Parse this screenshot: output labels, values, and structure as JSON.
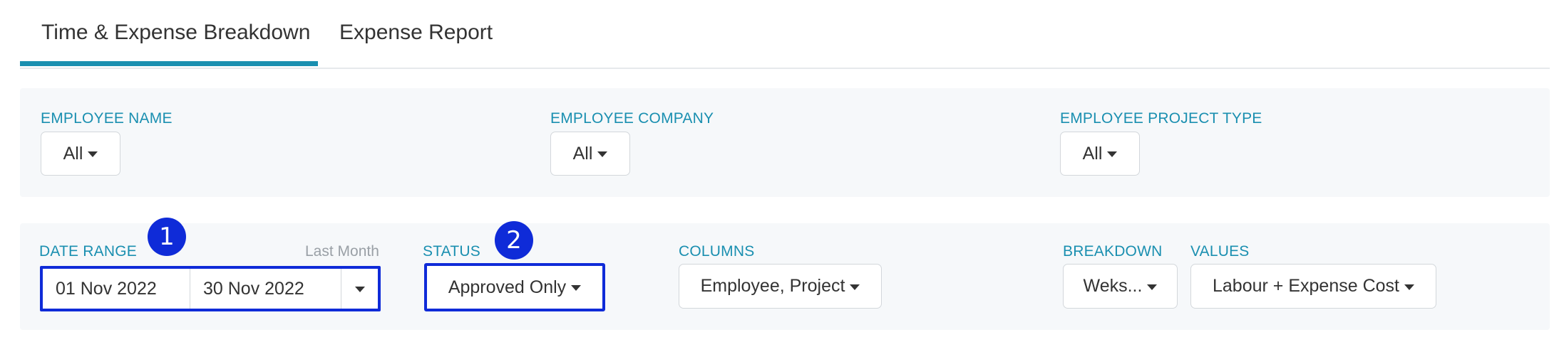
{
  "tabs": [
    {
      "label": "Time & Expense Breakdown",
      "active": true
    },
    {
      "label": "Expense Report",
      "active": false
    }
  ],
  "filters_top": {
    "employee_name": {
      "label": "EMPLOYEE NAME",
      "value": "All"
    },
    "employee_company": {
      "label": "EMPLOYEE COMPANY",
      "value": "All"
    },
    "employee_project_type": {
      "label": "EMPLOYEE PROJECT TYPE",
      "value": "All"
    }
  },
  "filters_bottom": {
    "date_range": {
      "label": "DATE RANGE",
      "hint": "Last Month",
      "start": "01 Nov 2022",
      "end": "30 Nov 2022"
    },
    "status": {
      "label": "STATUS",
      "value": "Approved Only"
    },
    "columns": {
      "label": "COLUMNS",
      "value": "Employee, Project"
    },
    "breakdown": {
      "label": "BREAKDOWN",
      "value": "Weks..."
    },
    "values": {
      "label": "VALUES",
      "value": "Labour + Expense Cost"
    }
  },
  "annotations": {
    "badge1": "1",
    "badge2": "2"
  },
  "colors": {
    "accent": "#1a8fb0",
    "highlight": "#0f2bd8",
    "panel_bg": "#f6f8fa"
  }
}
